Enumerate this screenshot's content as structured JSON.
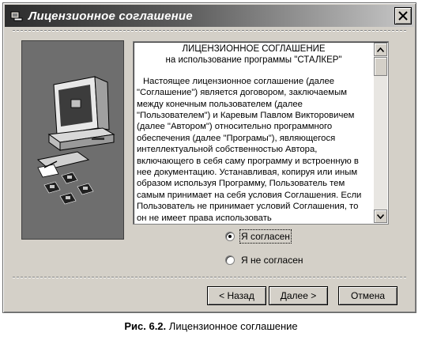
{
  "window": {
    "title": "Лицензионное соглашение",
    "title_icon": "installer-icon",
    "close_icon": "close-icon"
  },
  "license": {
    "heading": "ЛИЦЕНЗИОННОЕ СОГЛАШЕНИЕ",
    "subheading": "на использование программы \"СТАЛКЕР\"",
    "body": "Настоящее лицензионное соглашение (далее \"Соглашение\") является договором, заключаемым между конечным пользователем (далее \"Пользователем\") и Каревым Павлом Викторовичем (далее \"Автором\") относительно программного обеспечения (далее \"Програмы\"), являющегося интеллектуальной собственностью Автора, включающего в себя саму программу и встроенную в нее документацию. Устанавливая, копируя или иным образом используя Программу, Пользователь тем самым принимает на себя условия Соглашения. Если Пользователь не принимает условий Соглашения, то он не имеет права использовать"
  },
  "options": {
    "agree": "Я согласен",
    "disagree": "Я не согласен",
    "selected": "agree"
  },
  "buttons": {
    "back": "< Назад",
    "next": "Далее >",
    "cancel": "Отмена"
  },
  "caption": {
    "number": "Рис. 6.2.",
    "text": "Лицензионное соглашение"
  }
}
